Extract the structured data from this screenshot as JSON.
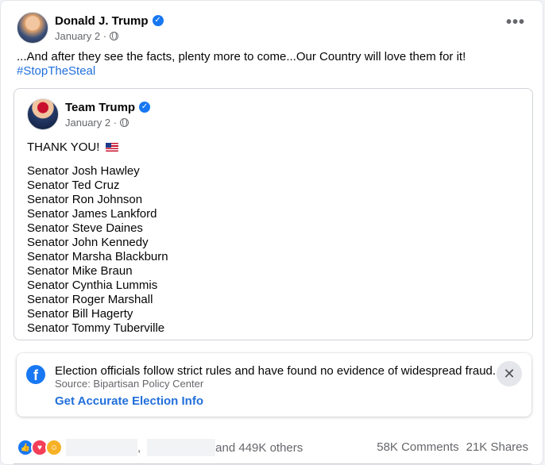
{
  "post": {
    "author": "Donald J. Trump",
    "date": "January 2 ·",
    "text": "...And after they see the facts, plenty more to come...Our Country will love them for it!",
    "hashtag": "#StopTheSteal",
    "more_icon": "•••"
  },
  "shared": {
    "author": "Team Trump",
    "date": "January 2 ·",
    "thanks": "THANK YOU!",
    "senators": [
      "Senator Josh Hawley",
      "Senator Ted Cruz",
      "Senator Ron Johnson",
      "Senator James Lankford",
      "Senator Steve Daines",
      "Senator John Kennedy",
      "Senator Marsha Blackburn",
      "Senator Mike Braun",
      "Senator Cynthia Lummis",
      "Senator Roger Marshall",
      "Senator Bill Hagerty",
      "Senator Tommy Tuberville"
    ]
  },
  "notice": {
    "text": "Election officials follow strict rules and have found no evidence of widespread fraud.",
    "source": "Source: Bipartisan Policy Center",
    "link": "Get Accurate Election Info",
    "close_icon": "✕"
  },
  "footer": {
    "separator": ",",
    "others": "and 449K others",
    "comments": "58K Comments",
    "shares": "21K Shares"
  },
  "colors": {
    "facebook_blue": "#1877f2",
    "link_blue": "#216fdb",
    "muted_text": "#65676b"
  },
  "icons": {
    "verified": "verified-badge-icon",
    "globe": "globe-icon",
    "facebook": "facebook-logo-icon",
    "flag": "us-flag-icon",
    "reactions": [
      "like-icon",
      "love-icon",
      "haha-icon"
    ]
  }
}
